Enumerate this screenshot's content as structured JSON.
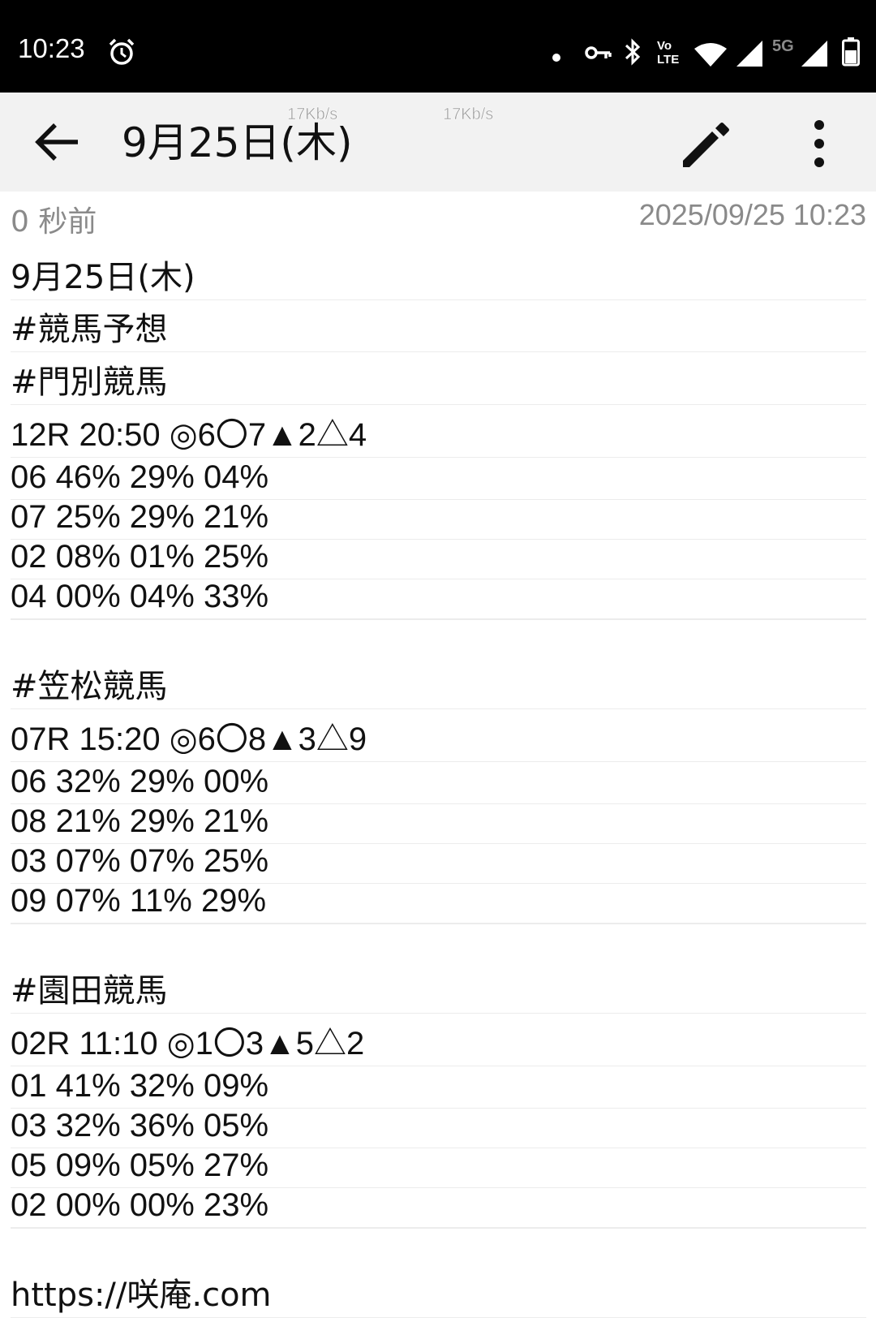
{
  "status_bar": {
    "time": "10:23",
    "icons": [
      "alarm-icon",
      "notification-dot-icon",
      "vpn-key-icon",
      "bluetooth-icon",
      "volte-icon",
      "wifi-icon",
      "signal-icon",
      "5g-signal-icon",
      "battery-icon"
    ],
    "volte_label_top": "Vo",
    "volte_label_bottom": "LTE",
    "network_label": "5G",
    "net_speed_1": "17Kb/s",
    "net_speed_2": "17Kb/s"
  },
  "app_bar": {
    "title": "9月25日(木)",
    "back_icon": "arrow-back-icon",
    "edit_icon": "pencil-icon",
    "more_icon": "more-vert-icon"
  },
  "meta": {
    "relative_time": "0 秒前",
    "datetime": "2025/09/25 10:23"
  },
  "note": {
    "lines": [
      "9月25日(木)",
      "#競馬予想",
      "#門別競馬",
      "12R 20:50 ◎6〇7▲2△4",
      "06 46% 29% 04%",
      "07 25% 29% 21%",
      "02 08% 01% 25%",
      "04 00% 04% 33%",
      "",
      "#笠松競馬",
      "07R 15:20 ◎6〇8▲3△9",
      "06 32% 29% 00%",
      "08 21% 29% 21%",
      "03 07% 07% 25%",
      "09 07% 11% 29%",
      "",
      "#園田競馬",
      "02R 11:10 ◎1〇3▲5△2",
      "01 41% 32% 09%",
      "03 32% 36% 05%",
      "05 09% 05% 27%",
      "02 00% 00% 23%",
      "",
      "https://咲庵.com"
    ]
  }
}
